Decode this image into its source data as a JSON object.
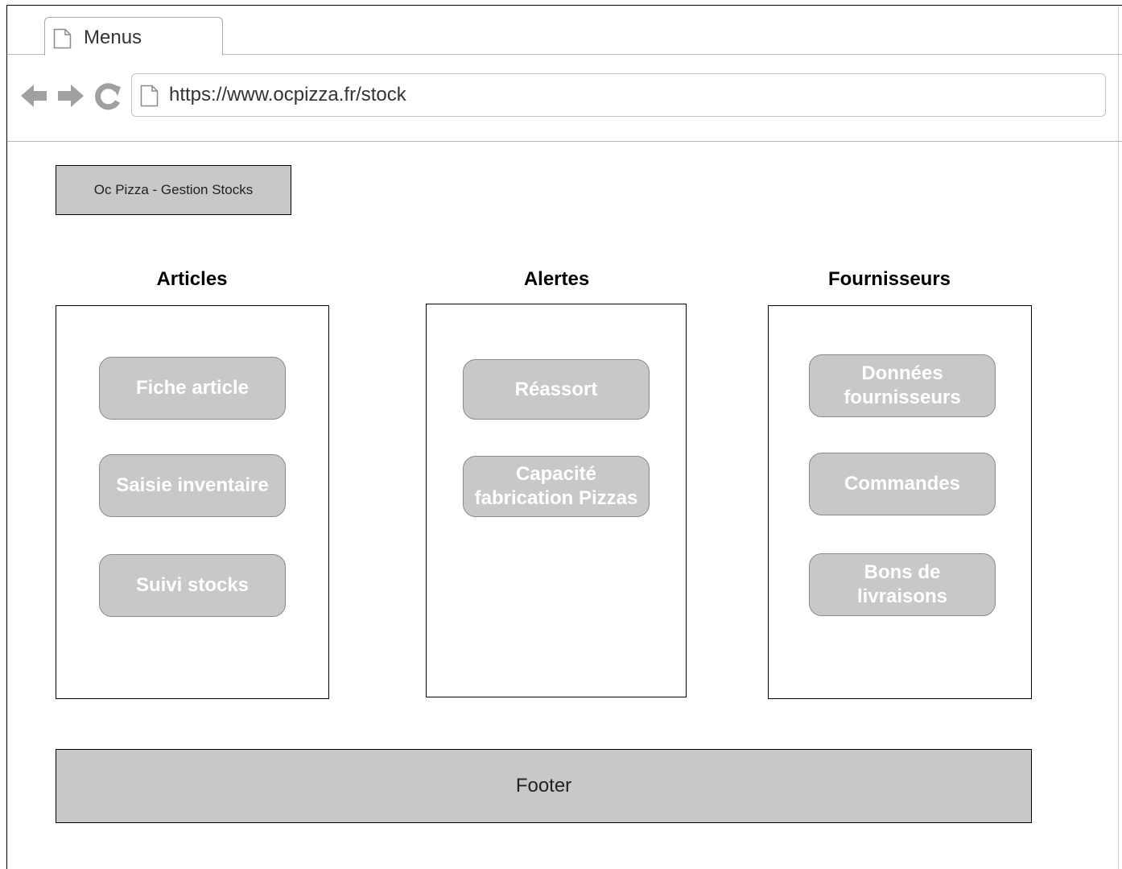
{
  "browser": {
    "tab_title": "Menus",
    "url": "https://www.ocpizza.fr/stock"
  },
  "header": {
    "brand": "Oc Pizza - Gestion Stocks"
  },
  "columns": [
    {
      "title": "Articles",
      "buttons": [
        "Fiche article",
        "Saisie inventaire",
        "Suivi stocks"
      ]
    },
    {
      "title": "Alertes",
      "buttons": [
        "Réassort",
        "Capacité\nfabrication Pizzas"
      ]
    },
    {
      "title": "Fournisseurs",
      "buttons": [
        "Données\nfournisseurs",
        "Commandes",
        "Bons de\nlivraisons"
      ]
    }
  ],
  "footer": {
    "label": "Footer"
  },
  "colors": {
    "button_fill": "#c8c8c8",
    "button_text": "#ffffff",
    "border": "#000000"
  }
}
